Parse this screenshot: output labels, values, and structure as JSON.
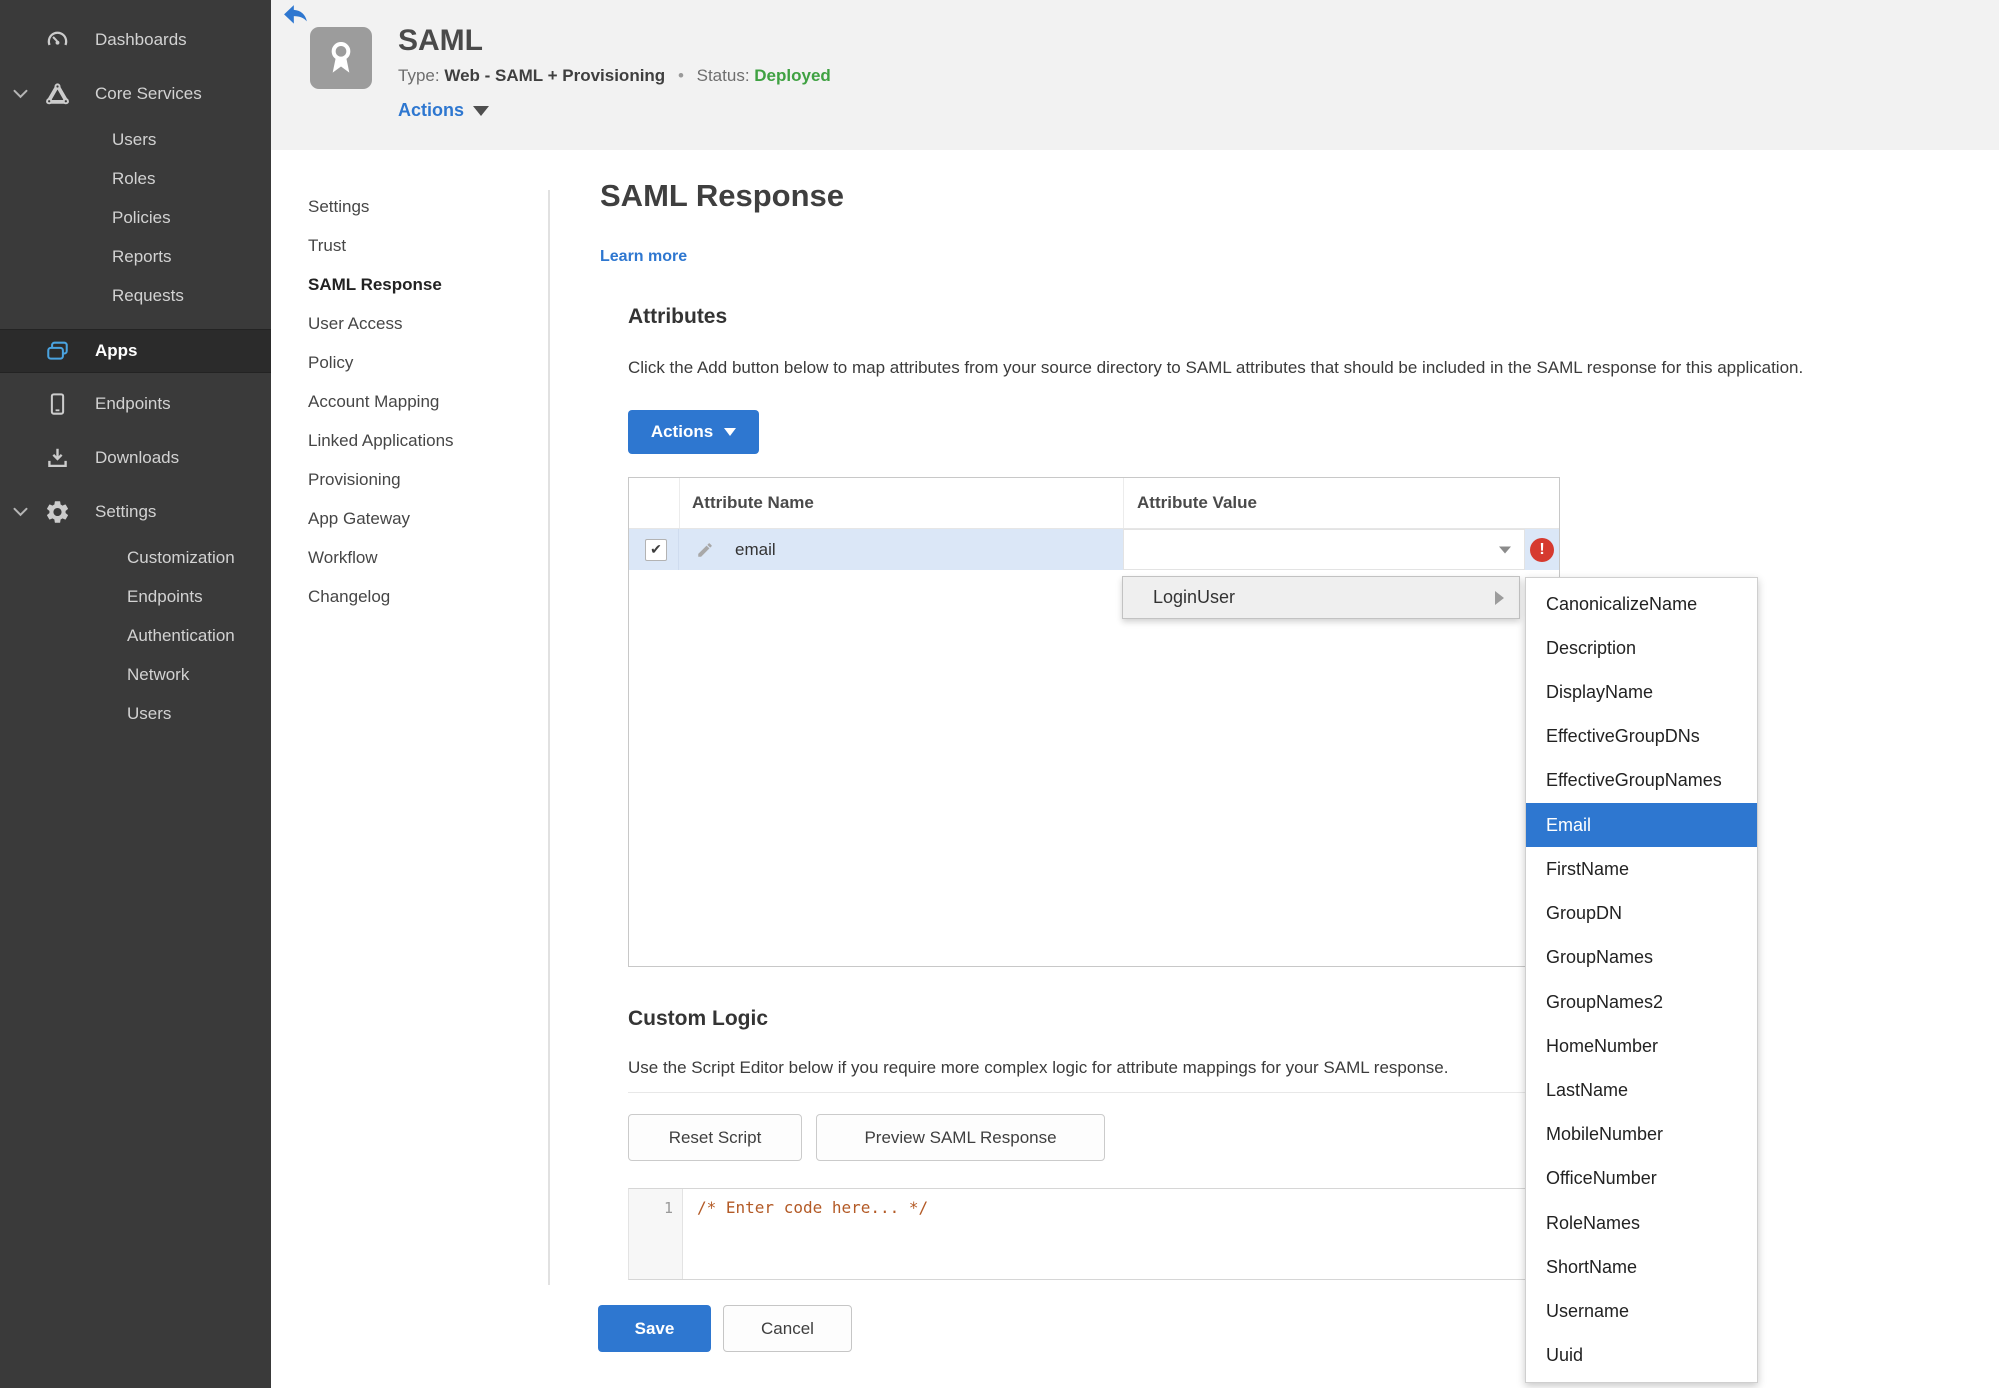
{
  "app": {
    "title": "SAML",
    "type_label": "Type:",
    "type_value": "Web - SAML + Provisioning",
    "dot": "•",
    "status_label": "Status:",
    "status_value": "Deployed",
    "actions_label": "Actions"
  },
  "sidebar": {
    "items": [
      {
        "label": "Dashboards",
        "icon": "gauge",
        "level": 0
      },
      {
        "label": "Core Services",
        "icon": "core-services",
        "level": 0,
        "chevron": true
      },
      {
        "label": "Users",
        "level": 1
      },
      {
        "label": "Roles",
        "level": 1
      },
      {
        "label": "Policies",
        "level": 1
      },
      {
        "label": "Reports",
        "level": 1
      },
      {
        "label": "Requests",
        "level": 1
      },
      {
        "label": "Apps",
        "icon": "apps",
        "level": 0,
        "active": true
      },
      {
        "label": "Endpoints",
        "icon": "smartphone",
        "level": 0
      },
      {
        "label": "Downloads",
        "icon": "download",
        "level": 0
      },
      {
        "label": "Settings",
        "icon": "gear",
        "level": 0,
        "chevron": true
      },
      {
        "label": "Customization",
        "level": 2
      },
      {
        "label": "Endpoints",
        "level": 2
      },
      {
        "label": "Authentication",
        "level": 2
      },
      {
        "label": "Network",
        "level": 2
      },
      {
        "label": "Users",
        "level": 2
      }
    ]
  },
  "subnav": {
    "active_index": 2,
    "items": [
      "Settings",
      "Trust",
      "SAML Response",
      "User Access",
      "Policy",
      "Account Mapping",
      "Linked Applications",
      "Provisioning",
      "App Gateway",
      "Workflow",
      "Changelog"
    ]
  },
  "main": {
    "title": "SAML Response",
    "learn_more": "Learn more",
    "attributes": {
      "heading": "Attributes",
      "description": "Click the Add button below to map attributes from your source directory to SAML attributes that should be included in the SAML response for this application.",
      "actions_button": "Actions",
      "table": {
        "columns": [
          "Attribute Name",
          "Attribute Value"
        ],
        "rows": [
          {
            "name": "email",
            "checked": true,
            "value": "",
            "error": true
          }
        ]
      }
    },
    "dropdown": {
      "label": "LoginUser",
      "submenu": {
        "selected": "Email",
        "items": [
          "CanonicalizeName",
          "Description",
          "DisplayName",
          "EffectiveGroupDNs",
          "EffectiveGroupNames",
          "Email",
          "FirstName",
          "GroupDN",
          "GroupNames",
          "GroupNames2",
          "HomeNumber",
          "LastName",
          "MobileNumber",
          "OfficeNumber",
          "RoleNames",
          "ShortName",
          "Username",
          "Uuid"
        ]
      }
    },
    "custom_logic": {
      "heading": "Custom Logic",
      "description": "Use the Script Editor below if you require more complex logic for attribute mappings for your SAML response.",
      "reset_button": "Reset Script",
      "preview_button": "Preview SAML Response",
      "editor": {
        "line_number": "1",
        "code": "/* Enter code here... */"
      }
    },
    "save_button": "Save",
    "cancel_button": "Cancel"
  },
  "icons": {
    "check": "✔",
    "error_mark": "!"
  },
  "colors": {
    "accent_blue": "#2e77d0",
    "status_green": "#3fa142",
    "error_red": "#d63a2f",
    "row_highlight": "#dbe7f7",
    "code_orange": "#b35a26",
    "sidebar_bg": "#3a3a3a",
    "apps_icon_blue": "#4aa3e0"
  }
}
